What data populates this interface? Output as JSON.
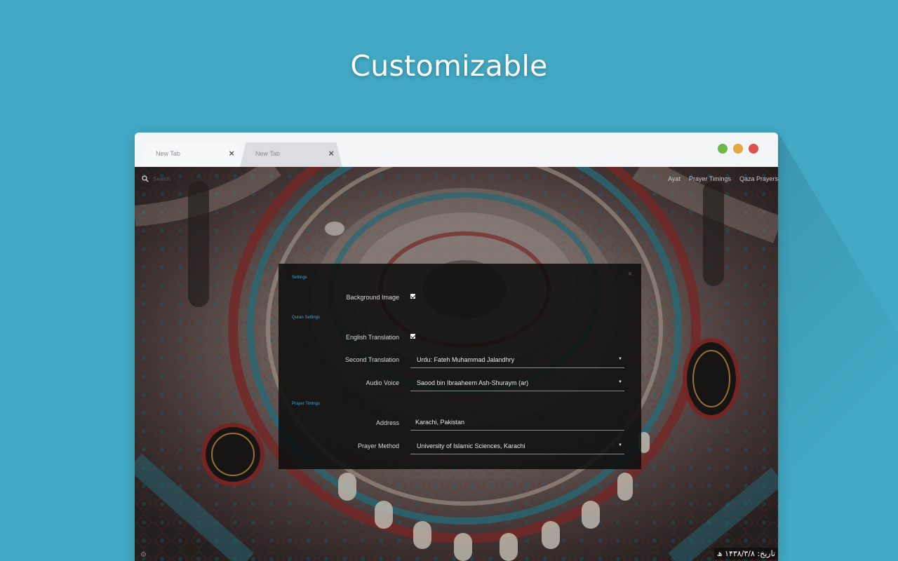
{
  "headline": "Customizable",
  "browser": {
    "tabs": [
      {
        "label": "New Tab",
        "close": "×"
      },
      {
        "label": "New Tab",
        "close": "×"
      }
    ]
  },
  "page": {
    "search_placeholder": "Search",
    "nav": [
      "Ayat",
      "Prayer Timings",
      "Qaza Prayers"
    ],
    "date": "تاریخ: ۱۴۳۸/۳/۸ ھ"
  },
  "settings": {
    "close": "×",
    "section_settings": "Settings",
    "background_image_label": "Background Image",
    "background_image_checked": true,
    "section_quran": "Quran Settings",
    "english_translation_label": "English Translation",
    "english_translation_checked": true,
    "second_translation_label": "Second Translation",
    "second_translation_value": "Urdu: Fateh Muhammad Jalandhry",
    "audio_voice_label": "Audio Voice",
    "audio_voice_value": "Saood bin Ibraaheem Ash-Shuraym (ar)",
    "section_prayer": "Prayer Timings",
    "address_label": "Address",
    "address_value": "Karachi, Pakistan",
    "prayer_method_label": "Prayer Method",
    "prayer_method_value": "University of Islamic Sciences, Karachi",
    "caret": "▼"
  },
  "colors": {
    "background": "#42a8c4",
    "accent_section": "#3fa6cf",
    "traffic_green": "#6cb84a",
    "traffic_yellow": "#e3a93e",
    "traffic_red": "#d9534f"
  }
}
